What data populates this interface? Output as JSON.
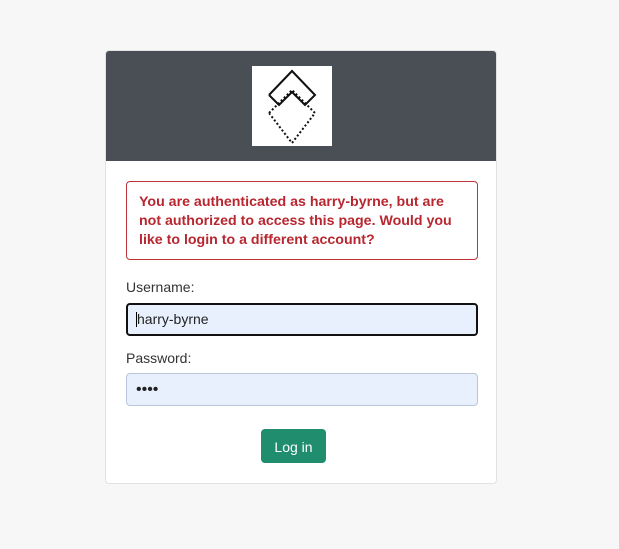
{
  "alert": {
    "message": "You are authenticated as harry-byrne, but are not authorized to access this page. Would you like to login to a different account?"
  },
  "form": {
    "username_label": "Username:",
    "username_value": "harry-byrne",
    "password_label": "Password:",
    "password_masked": "••••",
    "submit_label": "Log in"
  },
  "colors": {
    "header_bg": "#4a4e55",
    "alert_text": "#b8262f",
    "button_bg": "#1f8d6e",
    "input_bg": "#e8f0fe"
  },
  "icons": {
    "logo": "diamond-chevron-logo-icon"
  }
}
